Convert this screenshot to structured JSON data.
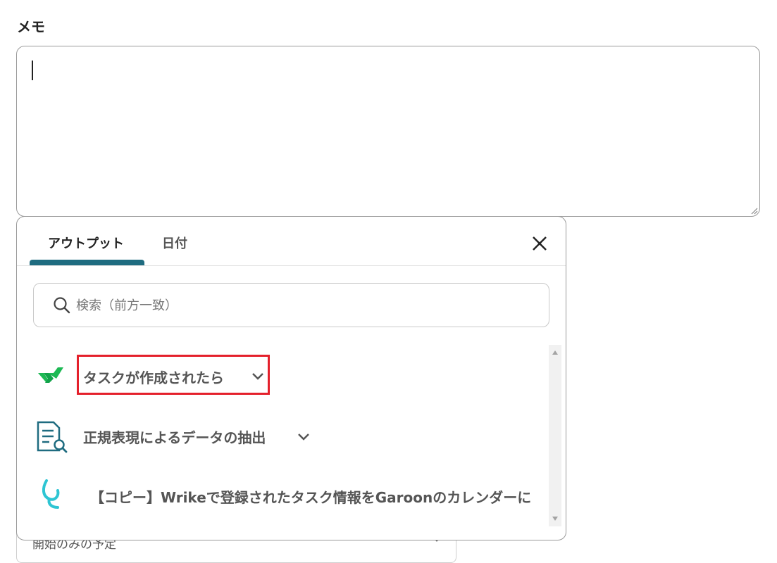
{
  "memo": {
    "label": "メモ",
    "value": ""
  },
  "background_field": {
    "value": "開始のみの予定"
  },
  "popup": {
    "tabs": [
      {
        "label": "アウトプット",
        "active": true
      },
      {
        "label": "日付",
        "active": false
      }
    ],
    "close_icon": "close-icon",
    "search": {
      "placeholder": "検索（前方一致）",
      "value": ""
    },
    "items": [
      {
        "label": "タスクが作成されたら",
        "icon": "wrike-check-icon",
        "highlighted": true
      },
      {
        "label": "正規表現によるデータの抽出",
        "icon": "document-search-icon",
        "highlighted": false
      },
      {
        "label": "【コピー】Wrikeで登録されたタスク情報をGaroonのカレンダーに",
        "icon": "yoom-logo-icon",
        "highlighted": false
      }
    ]
  },
  "colors": {
    "tab_accent": "#1f6c80",
    "highlight_border": "#e4202b",
    "wrike_green": "#1db954",
    "doc_icon_teal": "#1f6c80",
    "yoom_cyan": "#2ec5d3"
  }
}
